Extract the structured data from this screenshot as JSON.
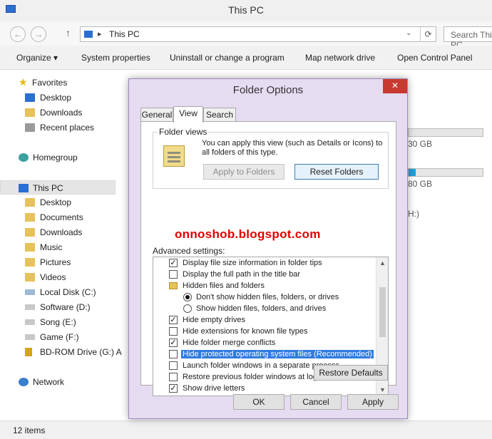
{
  "window": {
    "title": "This PC"
  },
  "nav": {
    "back": "←",
    "forward": "→",
    "up": "↑",
    "address_sep": "▸",
    "address": "This PC",
    "dropdown": "⌄",
    "refresh": "⟳",
    "search_placeholder": "Search This PC"
  },
  "ribbon": {
    "organize": "Organize ▾",
    "system_properties": "System properties",
    "uninstall": "Uninstall or change a program",
    "map_network": "Map network drive",
    "open_control_panel": "Open Control Panel"
  },
  "sidebar": {
    "favorites": "Favorites",
    "desktop": "Desktop",
    "downloads": "Downloads",
    "recent": "Recent places",
    "homegroup": "Homegroup",
    "thispc": "This PC",
    "pc_desktop": "Desktop",
    "documents": "Documents",
    "pc_downloads": "Downloads",
    "music": "Music",
    "pictures": "Pictures",
    "videos": "Videos",
    "local_disk": "Local Disk (C:)",
    "software": "Software (D:)",
    "song": "Song (E:)",
    "game": "Game (F:)",
    "bdrom": "BD-ROM Drive (G:) A",
    "network": "Network"
  },
  "content": {
    "text1": "30 GB",
    "text2": "80 GB",
    "text3": "H:)",
    "drive1_fraction": 0.0,
    "drive2_fraction": 0.1
  },
  "status": {
    "items": "12 items"
  },
  "dialog": {
    "title": "Folder Options",
    "close": "✕",
    "tabs": {
      "general": "General",
      "view": "View",
      "search": "Search"
    },
    "folder_views": {
      "label": "Folder views",
      "description": "You can apply this view (such as Details or Icons) to all folders of this type.",
      "apply": "Apply to Folders",
      "reset": "Reset Folders"
    },
    "watermark": "onnoshob.blogspot.com",
    "advanced_label": "Advanced settings:",
    "items": {
      "i0": "Display file size information in folder tips",
      "i1": "Display the full path in the title bar",
      "i2": "Hidden files and folders",
      "i3": "Don't show hidden files, folders, or drives",
      "i4": "Show hidden files, folders, and drives",
      "i5": "Hide empty drives",
      "i6": "Hide extensions for known file types",
      "i7": "Hide folder merge conflicts",
      "i8": "Hide protected operating system files (Recommended)",
      "i9": "Launch folder windows in a separate process",
      "i10": "Restore previous folder windows at logon",
      "i11": "Show drive letters"
    },
    "check_mark": "✓",
    "scroll_up": "▲",
    "scroll_down": "▼",
    "restore_defaults": "Restore Defaults",
    "ok": "OK",
    "cancel": "Cancel",
    "apply": "Apply"
  }
}
